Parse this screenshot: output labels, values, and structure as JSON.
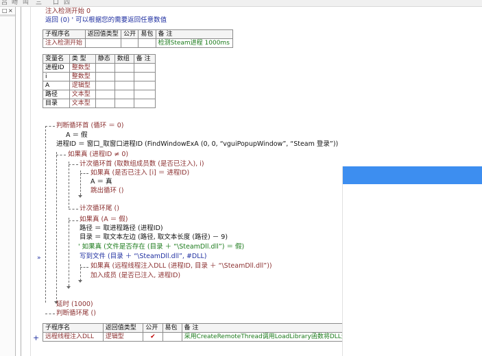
{
  "toolbar": {
    "glyphs": [
      "吕",
      "吻",
      "叫",
      "三",
      "口",
      "四"
    ]
  },
  "left_panel": {
    "buttons": [
      "□",
      "×"
    ]
  },
  "lines": {
    "sub_header": "注入检测开始  0",
    "return_comment": "返回 (0)  ' 可以根据您的需要返回任意数值",
    "loop_head": "判断循环首 (循环 ＝ 0)",
    "a_false": "A ＝ 假",
    "pid_assign": "进程ID ＝ 窗口_取窗口进程ID (FindWindowExA (0, 0, “vguiPopupWindow”, “Steam 登录”))",
    "if_pid": "如果真 (进程ID ≠ 0)",
    "count_loop": "计次循环首 (取数组成员数 (是否已注入), i)",
    "if_injected": "如果真 (是否已注入 [i] ＝ 进程ID)",
    "a_true": "A ＝ 真",
    "break_loop": "跳出循环 ()",
    "count_loop_end": "计次循环尾 ()",
    "if_a_false": "如果真 (A ＝ 假)",
    "path_assign": "路径 ＝ 取进程路径 (进程ID)",
    "dir_assign": "目录 ＝ 取文本左边 (路径, 取文本长度 (路径) － 9)",
    "comment_if_exists": "' 如果真 (文件是否存在 (目录 ＋ “\\SteamDll.dll”) ＝ 假)",
    "write_file": "写到文件 (目录 ＋ “\\SteamDll.dll”, #DLL)",
    "if_inject": "如果真 (远程线程注入DLL (进程ID, 目录 ＋ “\\SteamDll.dll”))",
    "add_member": "加入成员 (是否已注入, 进程ID)",
    "delay": "延时 (1000)",
    "loop_tail": "判断循环尾 ()"
  },
  "markers": {
    "arrow_marker": "»",
    "plus_marker": "+"
  },
  "sub_table_1": {
    "headers": [
      "子程序名",
      "返回值类型",
      "公开",
      "易包",
      "备 注"
    ],
    "row": [
      "注入检测开始",
      "",
      "",
      "",
      "检测Steam进程 1000ms"
    ]
  },
  "var_table": {
    "headers": [
      "变量名",
      "类 型",
      "静态",
      "数组",
      "备 注"
    ],
    "rows": [
      [
        "进程ID",
        "整数型",
        "",
        "",
        ""
      ],
      [
        "i",
        "整数型",
        "",
        "",
        ""
      ],
      [
        "A",
        "逻辑型",
        "",
        "",
        ""
      ],
      [
        "路径",
        "文本型",
        "",
        "",
        ""
      ],
      [
        "目录",
        "文本型",
        "",
        "",
        ""
      ]
    ]
  },
  "sub_table_2": {
    "headers": [
      "子程序名",
      "返回值类型",
      "公开",
      "易包",
      "备 注"
    ],
    "row": [
      "远程线程注入DLL",
      "逻辑型",
      "✔",
      "",
      "采用CreateRemoteThread调用LoadLibrary函数将DLL注入目"
    ]
  },
  "colors": {
    "overlay_bar": "#3d8ef0",
    "keyword": "#8b2f2f",
    "command": "#1f2fa0",
    "check": "#c00000"
  }
}
